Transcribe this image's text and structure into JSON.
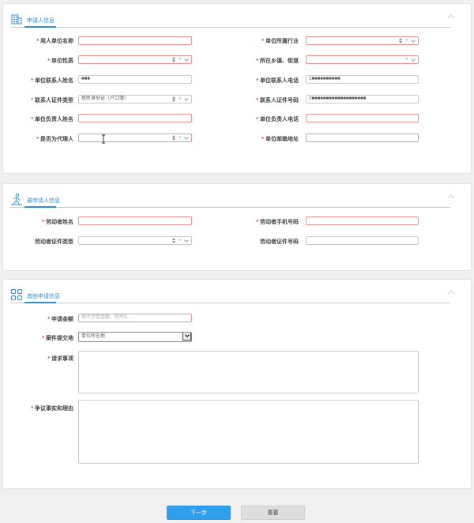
{
  "section1": {
    "title": "申请人信息",
    "fields": {
      "employer_name": {
        "label": "用人单位名称",
        "value": ""
      },
      "industry": {
        "label": "单位所属行业",
        "value": ""
      },
      "unit_nature": {
        "label": "单位性质",
        "value": ""
      },
      "town_street": {
        "label": "所在乡镇、街道",
        "value": ""
      },
      "contact_name": {
        "label": "单位联系人姓名",
        "value": "■■■"
      },
      "contact_phone": {
        "label": "单位联系人电话",
        "value": "1■■■■■■■■■■"
      },
      "id_type": {
        "label": "联系人证件类型",
        "value": "居民身份证（户口簿）"
      },
      "id_number": {
        "label": "联系人证件号码",
        "value": "3■■■■■■■■■■■■■■■■■■■"
      },
      "leader_name": {
        "label": "单位负责人姓名",
        "value": ""
      },
      "leader_phone": {
        "label": "单位负责人电话",
        "value": ""
      },
      "is_agent": {
        "label": "是否为代理人",
        "value": ""
      },
      "email": {
        "label": "单位邮箱地址",
        "value": ""
      }
    }
  },
  "section2": {
    "title": "被申请人信息",
    "fields": {
      "worker_name": {
        "label": "劳动者姓名",
        "value": ""
      },
      "worker_phone": {
        "label": "劳动者手机号码",
        "value": ""
      },
      "worker_id_type": {
        "label": "劳动者证件类型",
        "value": ""
      },
      "worker_id_number": {
        "label": "劳动者证件号码",
        "value": ""
      }
    }
  },
  "section3": {
    "title": "其他申请信息",
    "fields": {
      "amount": {
        "label": "申请金额",
        "placeholder": "如不涉及金额，则写0。"
      },
      "submit_place": {
        "label": "案件提交地",
        "value": "单位所在地"
      },
      "requests": {
        "label": "请求事项"
      },
      "facts": {
        "label": "争议事实和理由"
      }
    }
  },
  "buttons": {
    "next": "下一步",
    "reset": "重置"
  },
  "colors": {
    "accent": "#2fa0ee",
    "required": "#e03a3a",
    "error_border": "#f08f8f"
  }
}
